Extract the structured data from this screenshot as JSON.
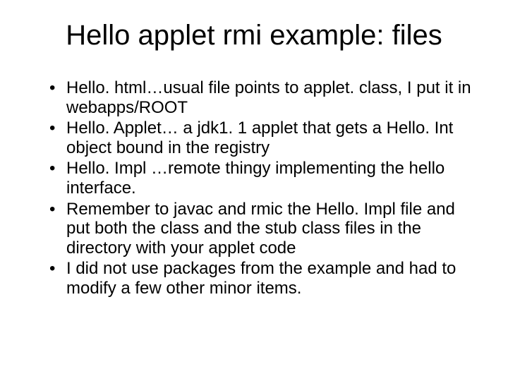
{
  "slide": {
    "title": "Hello applet rmi example: files",
    "bullets": [
      "Hello. html…usual file points to applet. class, I put it in webapps/ROOT",
      "Hello. Applet… a jdk1. 1 applet that gets a Hello. Int object bound in the registry",
      "Hello. Impl …remote thingy implementing the hello interface.",
      "Remember to javac and rmic the Hello. Impl file and put both the class and the stub class files in the directory with your applet code",
      "I did not use packages from the example and had to modify a few other minor items."
    ]
  }
}
